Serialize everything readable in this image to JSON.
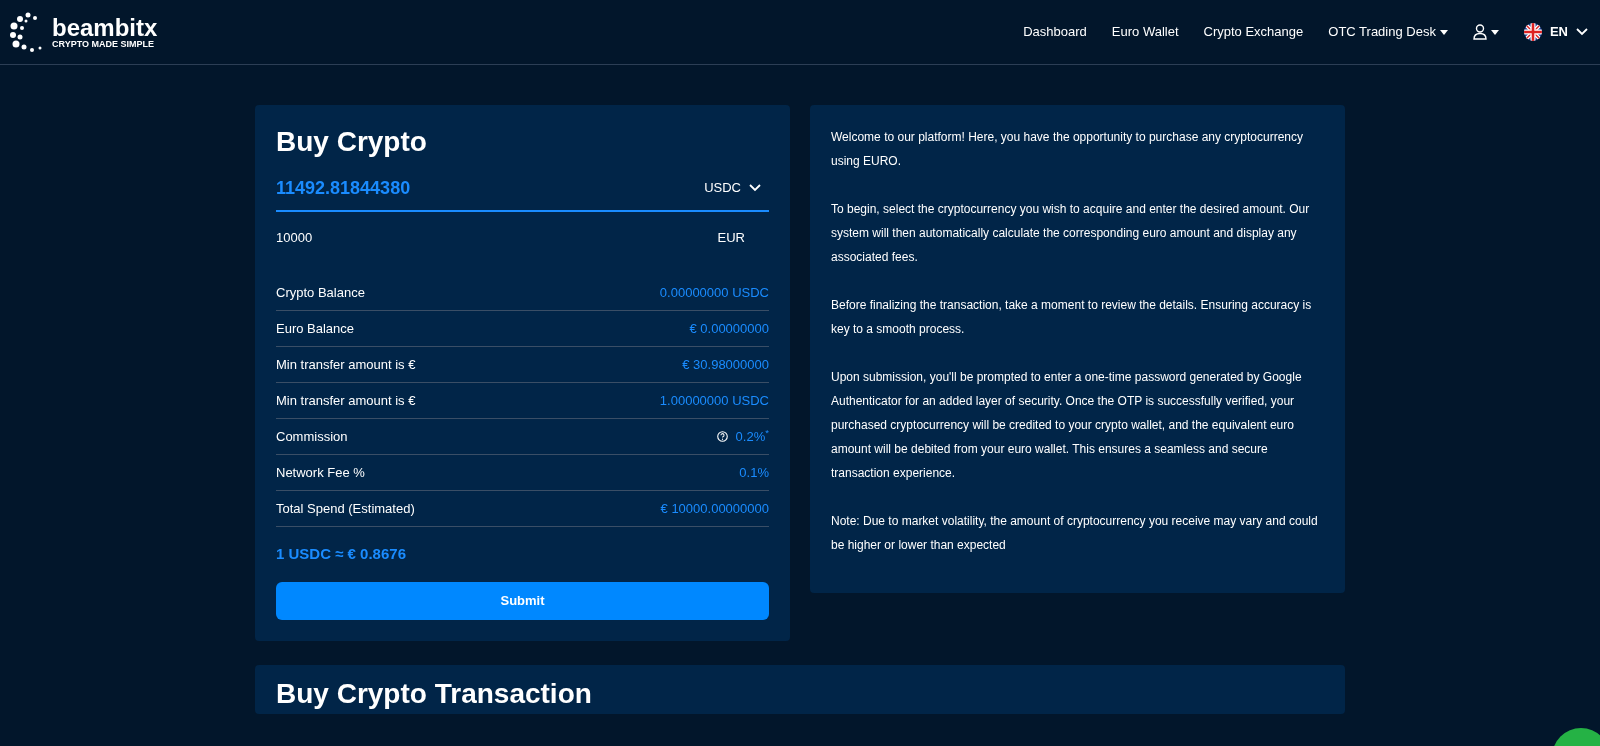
{
  "brand": {
    "name": "beambitx",
    "tagline": "CRYPTO MADE SIMPLE"
  },
  "nav": [
    {
      "label": "Dashboard",
      "dropdown": false
    },
    {
      "label": "Euro Wallet",
      "dropdown": false
    },
    {
      "label": "Crypto Exchange",
      "dropdown": false
    },
    {
      "label": "OTC Trading Desk",
      "dropdown": true
    }
  ],
  "language": "EN",
  "buy_card": {
    "title": "Buy Crypto",
    "crypto_amount": "11492.81844380",
    "crypto_currency": "USDC",
    "euro_amount": "10000",
    "euro_currency": "EUR",
    "rows": [
      {
        "label": "Crypto Balance",
        "value": "0.00000000 USDC",
        "help": false
      },
      {
        "label": "Euro Balance",
        "value": "€ 0.00000000",
        "help": false
      },
      {
        "label": "Min transfer amount is €",
        "value": "€ 30.98000000",
        "help": false
      },
      {
        "label": "Min transfer amount is €",
        "value": "1.00000000 USDC",
        "help": false
      },
      {
        "label": "Commission",
        "value": "0.2%$^{*}$",
        "help": true
      },
      {
        "label": "Network Fee %",
        "value": "0.1%",
        "help": false
      },
      {
        "label": "Total Spend (Estimated)",
        "value": "€ 10000.00000000",
        "help": false
      }
    ],
    "rate": "1 USDC ≈ € 0.8676",
    "submit": "Submit"
  },
  "info_paragraphs": [
    "Welcome to our platform! Here, you have the opportunity to purchase any cryptocurrency using EURO.",
    "To begin, select the cryptocurrency you wish to acquire and enter the desired amount. Our system will then automatically calculate the corresponding euro amount and display any associated fees.",
    "Before finalizing the transaction, take a moment to review the details. Ensuring accuracy is key to a smooth process.",
    "Upon submission, you'll be prompted to enter a one-time password generated by Google Authenticator for an added layer of security. Once the OTP is successfully verified, your purchased cryptocurrency will be credited to your crypto wallet, and the equivalent euro amount will be debited from your euro wallet. This ensures a seamless and secure transaction experience.",
    "Note: Due to market volatility, the amount of cryptocurrency you receive may vary and could be higher or lower than expected"
  ],
  "transactions_title": "Buy Crypto Transaction"
}
